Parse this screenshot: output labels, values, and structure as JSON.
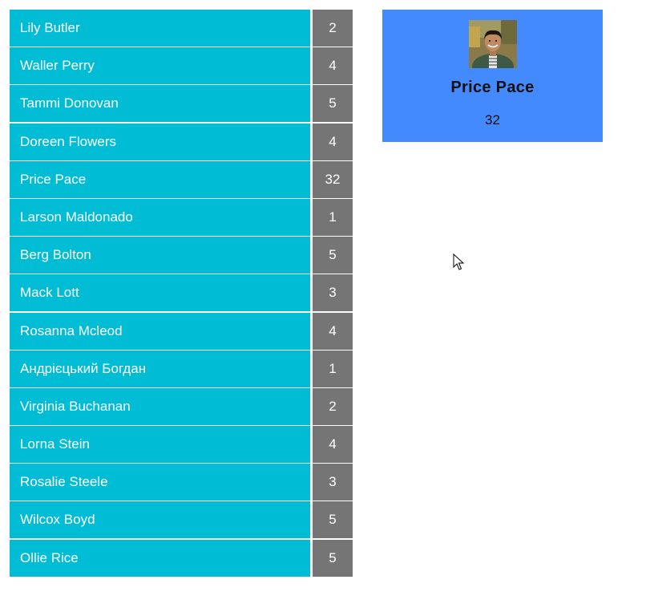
{
  "people": [
    {
      "name": "Lily Butler",
      "count": "2"
    },
    {
      "name": "Waller Perry",
      "count": "4"
    },
    {
      "name": "Tammi Donovan",
      "count": "5"
    },
    {
      "name": "Doreen Flowers",
      "count": "4"
    },
    {
      "name": "Price Pace",
      "count": "32"
    },
    {
      "name": "Larson Maldonado",
      "count": "1"
    },
    {
      "name": "Berg Bolton",
      "count": "5"
    },
    {
      "name": "Mack Lott",
      "count": "3"
    },
    {
      "name": "Rosanna Mcleod",
      "count": "4"
    },
    {
      "name": "Андрієцький Богдан",
      "count": "1"
    },
    {
      "name": "Virginia Buchanan",
      "count": "2"
    },
    {
      "name": "Lorna Stein",
      "count": "4"
    },
    {
      "name": "Rosalie Steele",
      "count": "3"
    },
    {
      "name": "Wilcox Boyd",
      "count": "5"
    },
    {
      "name": "Ollie Rice",
      "count": "5"
    }
  ],
  "selected": {
    "name": "Price Pace",
    "count": "32",
    "avatar_icon": "user-photo-icon"
  },
  "colors": {
    "row_name_bg": "#00bcd4",
    "row_count_bg": "#757575",
    "card_bg": "#448aff"
  }
}
